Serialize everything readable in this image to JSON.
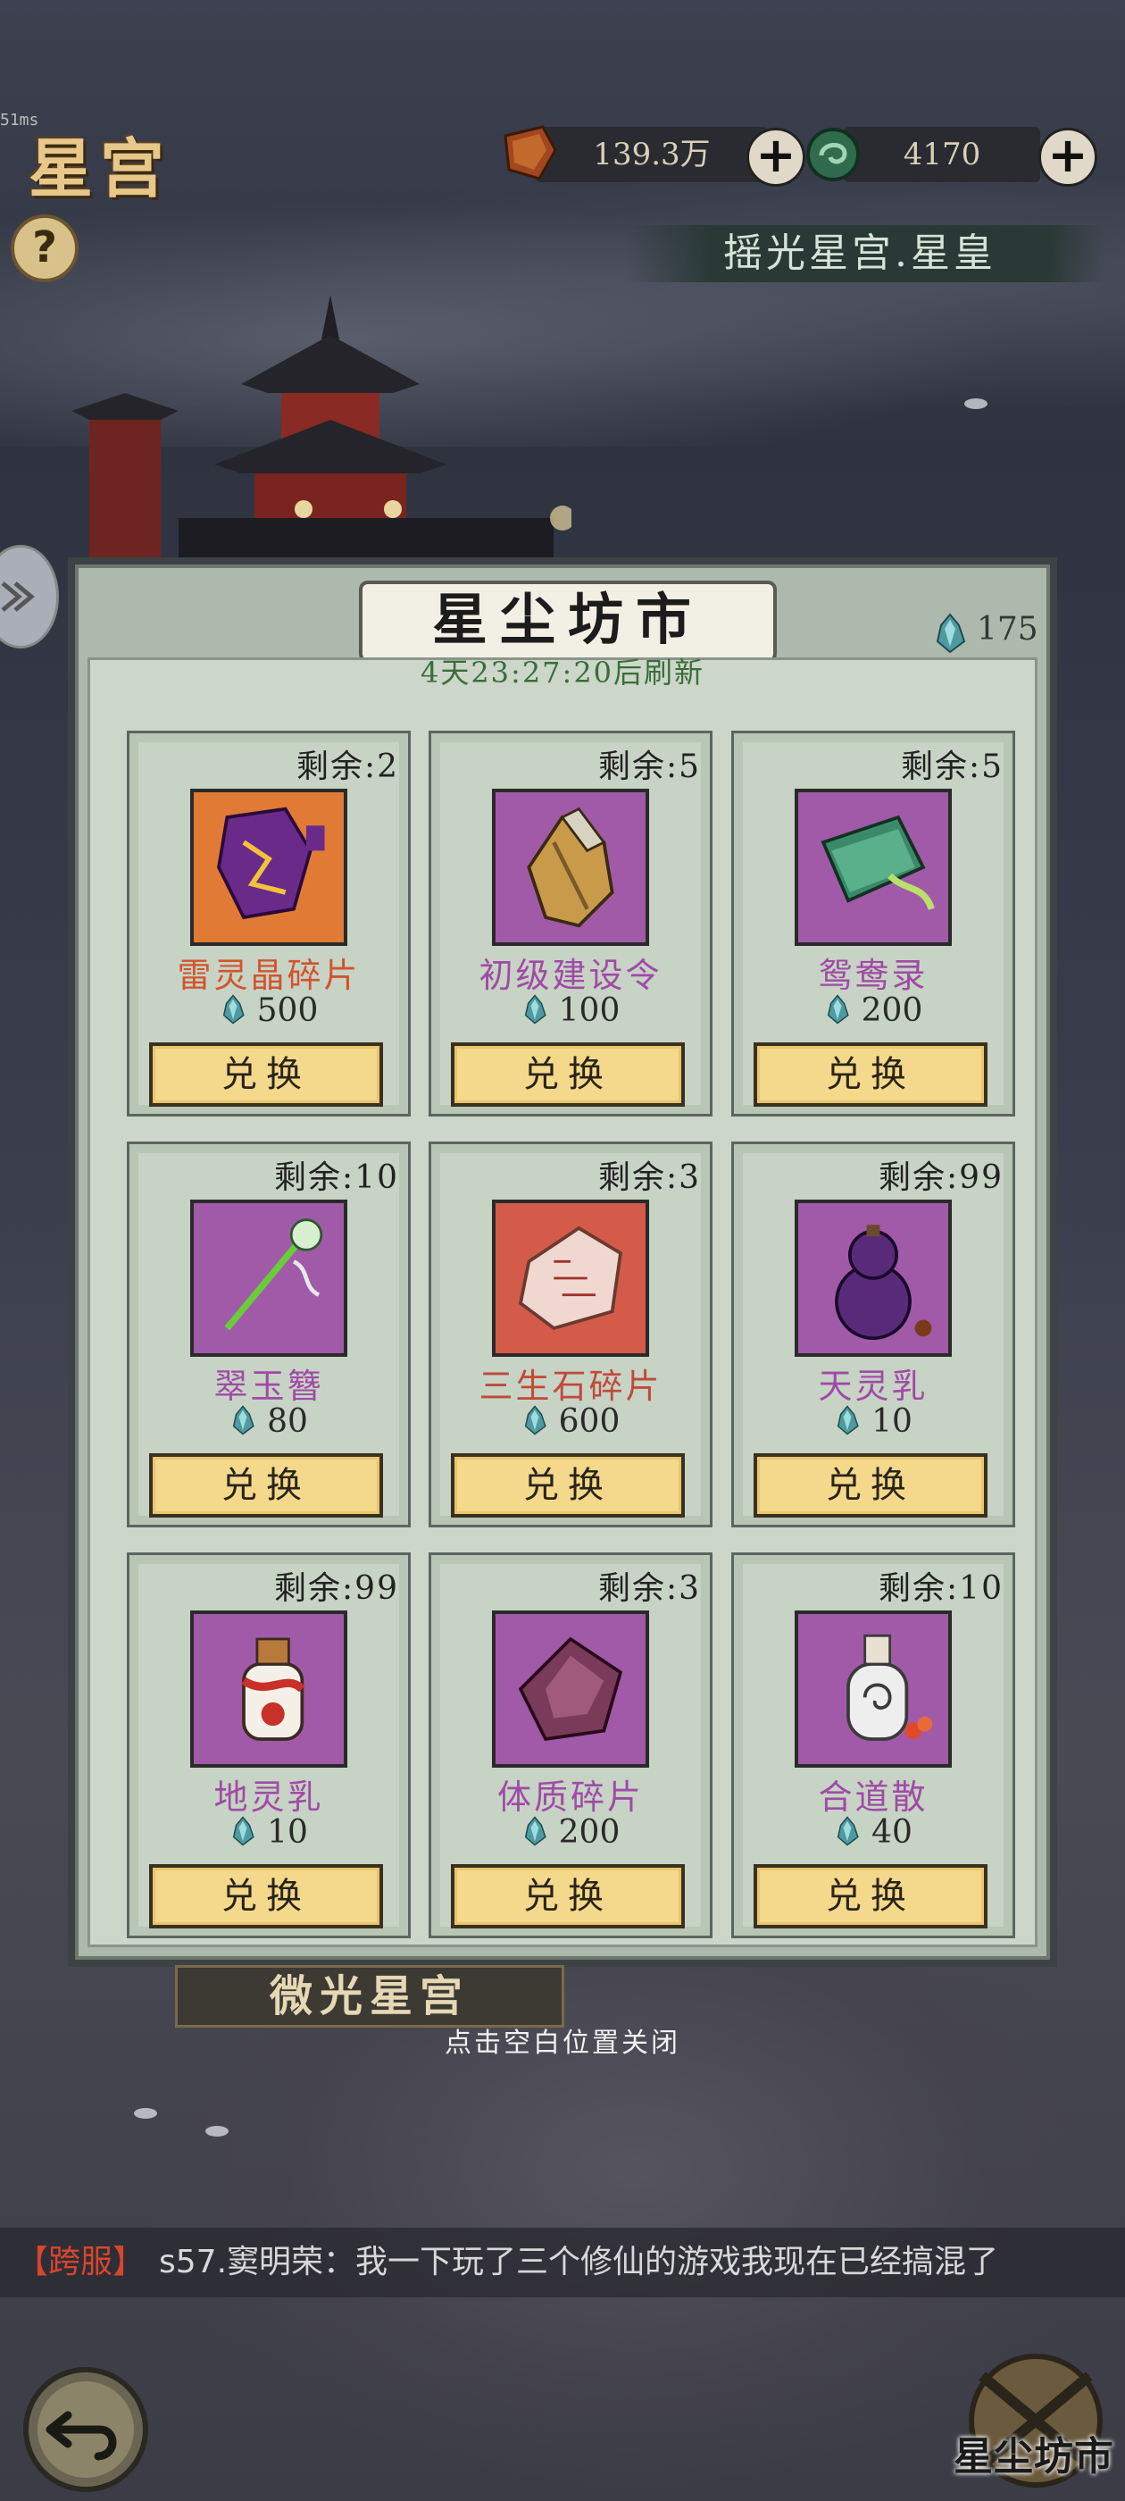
{
  "header": {
    "title": "星宫",
    "fps_text": "51ms",
    "help_label": "?",
    "resources": [
      {
        "icon": "ore-icon",
        "value": "139.3万"
      },
      {
        "icon": "jade-icon",
        "value": "4170"
      }
    ],
    "plus_label": "+",
    "rank_title": "摇光星宫.星皇"
  },
  "dialog": {
    "title": "星尘坊市",
    "currency_count": "175",
    "refresh_text": "4天23:27:20后刷新",
    "exchange_label": "兑换",
    "items": [
      {
        "remain": "剩余:2",
        "name": "雷灵晶碎片",
        "price": "500",
        "name_color": "#d2542e",
        "icon": "lightning-crystal-fragment-icon",
        "bg": "#e07a34"
      },
      {
        "remain": "剩余:5",
        "name": "初级建设令",
        "price": "100",
        "name_color": "#a04aa8",
        "icon": "construction-token-icon",
        "bg": "#a05aa8"
      },
      {
        "remain": "剩余:5",
        "name": "鸳鸯录",
        "price": "200",
        "name_color": "#a04aa8",
        "icon": "mandarin-duck-book-icon",
        "bg": "#a05aa8"
      },
      {
        "remain": "剩余:10",
        "name": "翠玉簪",
        "price": "80",
        "name_color": "#a04aa8",
        "icon": "jade-hairpin-icon",
        "bg": "#a05aa8"
      },
      {
        "remain": "剩余:3",
        "name": "三生石碎片",
        "price": "600",
        "name_color": "#c04a3a",
        "icon": "sansheng-stone-fragment-icon",
        "bg": "#d45a4a"
      },
      {
        "remain": "剩余:99",
        "name": "天灵乳",
        "price": "10",
        "name_color": "#a04aa8",
        "icon": "gourd-icon",
        "bg": "#a05aa8"
      },
      {
        "remain": "剩余:99",
        "name": "地灵乳",
        "price": "10",
        "name_color": "#a04aa8",
        "icon": "earth-milk-jar-icon",
        "bg": "#a05aa8"
      },
      {
        "remain": "剩余:3",
        "name": "体质碎片",
        "price": "200",
        "name_color": "#a04aa8",
        "icon": "physique-crystal-fragment-icon",
        "bg": "#a05aa8"
      },
      {
        "remain": "剩余:10",
        "name": "合道散",
        "price": "40",
        "name_color": "#a04aa8",
        "icon": "medicine-bottle-icon",
        "bg": "#a05aa8"
      }
    ]
  },
  "footer": {
    "sub_plaque": "微光星宫",
    "close_hint": "点击空白位置关闭",
    "chat_tag": "【跨服】",
    "chat_message": "s57.窦明荣：我一下玩了三个修仙的游戏我现在已经搞混了",
    "market_label": "星尘坊市"
  }
}
